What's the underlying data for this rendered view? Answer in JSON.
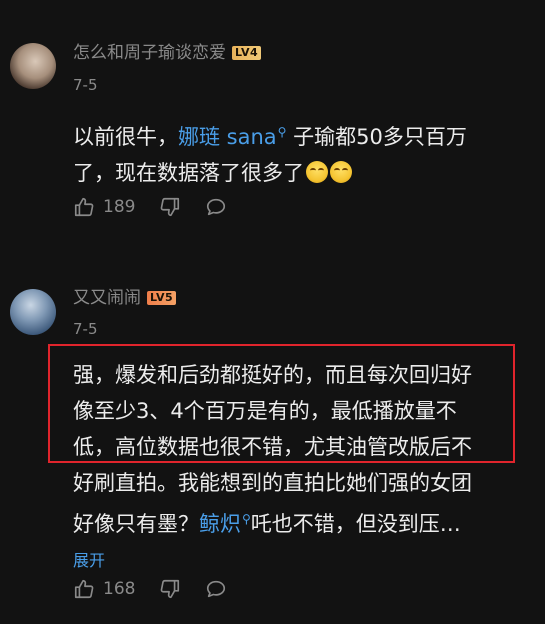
{
  "comments": [
    {
      "username": "怎么和周子瑜谈恋爱",
      "level": "LV4",
      "date": "7-5",
      "text_before": "以前很牛，",
      "mention": "娜琏 sana",
      "text_after_line1": " 子瑜都50多只百万",
      "text_line2": "了，现在数据落了很多了",
      "emojis": [
        "crying-laugh-emoji",
        "crying-laugh-emoji"
      ],
      "likes": "189"
    },
    {
      "username": "又又闹闹",
      "level": "LV5",
      "date": "7-5",
      "lines": [
        "强，爆发和后劲都挺好的，而且每次回归好",
        "像至少3、4个百万是有的，最低播放量不",
        "低，高位数据也很不错，尤其油管改版后不",
        "好刷直拍。我能想到的直拍比她们强的女团"
      ],
      "line5_before": "好像只有墨？",
      "mention": "鲸炽",
      "line5_after": "吒也不错，但没到压…",
      "expand_label": "展开",
      "likes": "168"
    }
  ],
  "icons": {
    "like": "thumbs-up-icon",
    "dislike": "thumbs-down-icon",
    "reply": "comment-bubble-icon",
    "mention": "search-icon"
  },
  "colors": {
    "background": "#121212",
    "mention": "#4a9ee8",
    "highlight": "#e0242c"
  }
}
